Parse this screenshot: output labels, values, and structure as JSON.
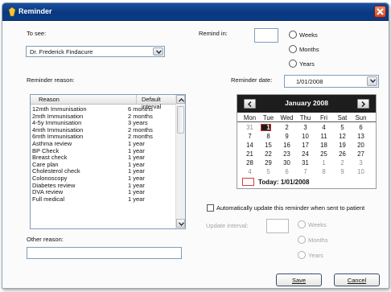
{
  "window": {
    "title": "Reminder"
  },
  "to_see": {
    "label": "To see:",
    "value": "Dr. Frederick Findacure"
  },
  "remind_in": {
    "label": "Remind in:",
    "value": "",
    "options": [
      "Weeks",
      "Months",
      "Years"
    ]
  },
  "reminder_reason": {
    "label": "Reminder reason:",
    "columns": [
      "Reason",
      "Default interval"
    ],
    "rows": [
      [
        "12mth Immunisation",
        "6 months"
      ],
      [
        "2mth Immunisation",
        "2 months"
      ],
      [
        "4-5y Immunisation",
        "3 years"
      ],
      [
        "4mth Immunisation",
        "2 months"
      ],
      [
        "6mth Immunisation",
        "2 months"
      ],
      [
        "Asthma review",
        "1 year"
      ],
      [
        "BP Check",
        "1 year"
      ],
      [
        "Breast check",
        "1 year"
      ],
      [
        "Care plan",
        "1 year"
      ],
      [
        "Cholesterol check",
        "1 year"
      ],
      [
        "Colonoscopy",
        "1 year"
      ],
      [
        "Diabetes review",
        "1 year"
      ],
      [
        "DVA review",
        "1 year"
      ],
      [
        "Full medical",
        "1 year"
      ]
    ]
  },
  "reminder_date": {
    "label": "Reminder date:",
    "value": "1/01/2008"
  },
  "calendar": {
    "month": "January 2008",
    "weekdays": [
      "Mon",
      "Tue",
      "Wed",
      "Thu",
      "Fri",
      "Sat",
      "Sun"
    ],
    "weeks": [
      [
        "31",
        "1",
        "2",
        "3",
        "4",
        "5",
        "6"
      ],
      [
        "7",
        "8",
        "9",
        "10",
        "11",
        "12",
        "13"
      ],
      [
        "14",
        "15",
        "16",
        "17",
        "18",
        "19",
        "20"
      ],
      [
        "21",
        "22",
        "23",
        "24",
        "25",
        "26",
        "27"
      ],
      [
        "28",
        "29",
        "30",
        "31",
        "1",
        "2",
        "3"
      ],
      [
        "4",
        "5",
        "6",
        "7",
        "8",
        "9",
        "10"
      ]
    ],
    "today_label": "Today: 1/01/2008"
  },
  "auto_update": {
    "label": "Automatically update this reminder when sent to patient",
    "checked": false
  },
  "update_interval": {
    "label": "Update interval:",
    "value": "",
    "options": [
      "Weeks",
      "Months",
      "Years"
    ]
  },
  "other_reason": {
    "label": "Other reason:",
    "value": ""
  },
  "buttons": {
    "save": "Save",
    "cancel": "Cancel"
  },
  "colors": {
    "titlebar": "#0a3880",
    "calendar_header": "#1d1d1d",
    "today_border": "#d04040",
    "disabled_text": "#a4a4a4"
  }
}
